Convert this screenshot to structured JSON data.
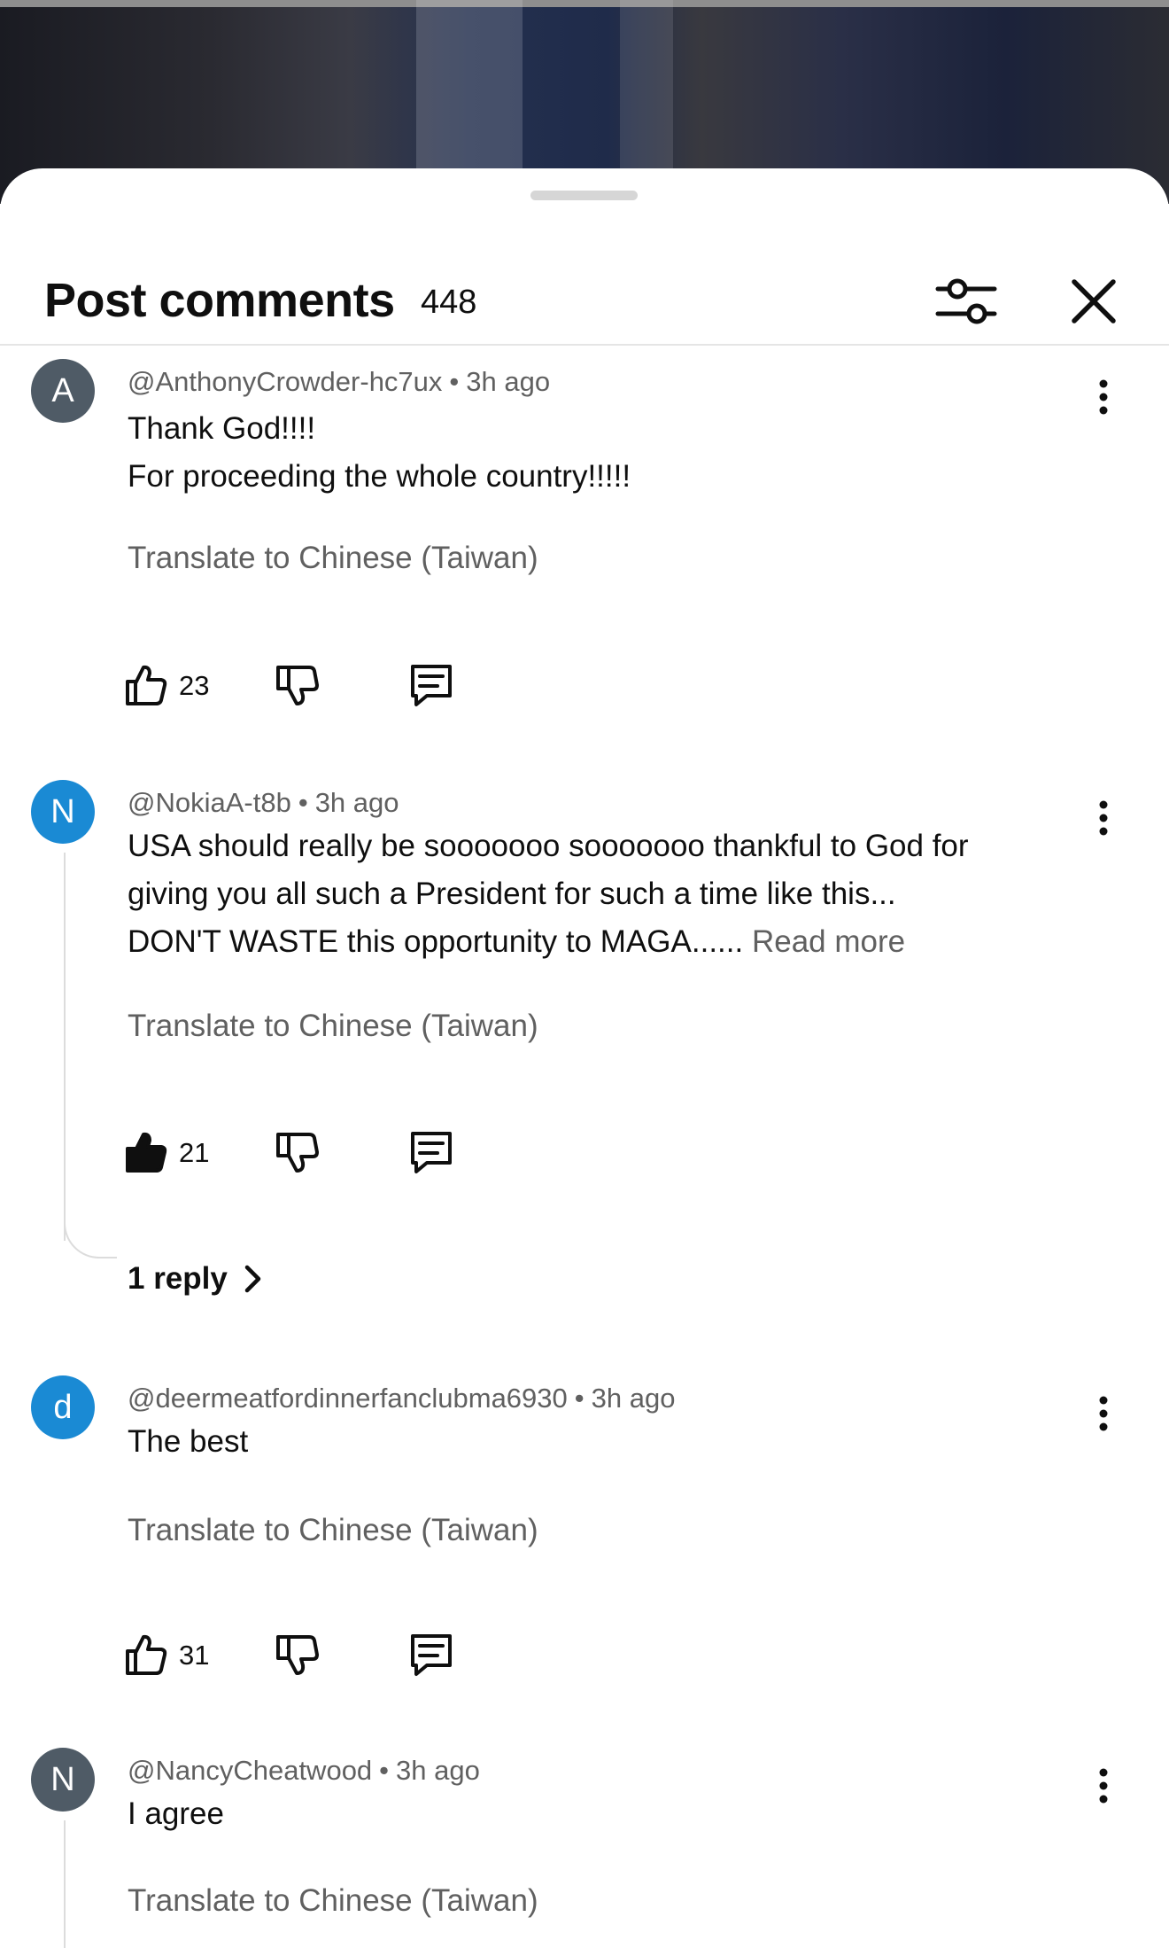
{
  "header": {
    "title": "Post comments",
    "count": "448",
    "filter_icon": "sliders-icon",
    "close_icon": "close-icon"
  },
  "translate_label": "Translate to Chinese (Taiwan)",
  "comments": [
    {
      "avatar_letter": "A",
      "avatar_color": "#4f5b66",
      "author": "@AnthonyCrowder-hc7ux",
      "time": "3h ago",
      "lines": [
        "Thank God!!!!",
        "For proceeding the whole country!!!!!"
      ],
      "likes": "23",
      "liked": false
    },
    {
      "avatar_letter": "N",
      "avatar_color": "#1a8ad4",
      "author": "@NokiaA-t8b",
      "time": "3h ago",
      "lines": [
        "USA should really be sooooooo sooooooo thankful to God for",
        "giving you all such a President for such a time like this...",
        "DON'T WASTE this opportunity to MAGA......"
      ],
      "read_more": "Read more",
      "likes": "21",
      "liked": true,
      "replies": "1 reply"
    },
    {
      "avatar_letter": "d",
      "avatar_color": "#1a8ad4",
      "author": "@deermeatfordinnerfanclubma6930",
      "time": "3h ago",
      "lines": [
        "The best"
      ],
      "likes": "31",
      "liked": false
    },
    {
      "avatar_letter": "N",
      "avatar_color": "#4f5b66",
      "author": "@NancyCheatwood",
      "time": "3h ago",
      "lines": [
        "I agree"
      ]
    }
  ]
}
